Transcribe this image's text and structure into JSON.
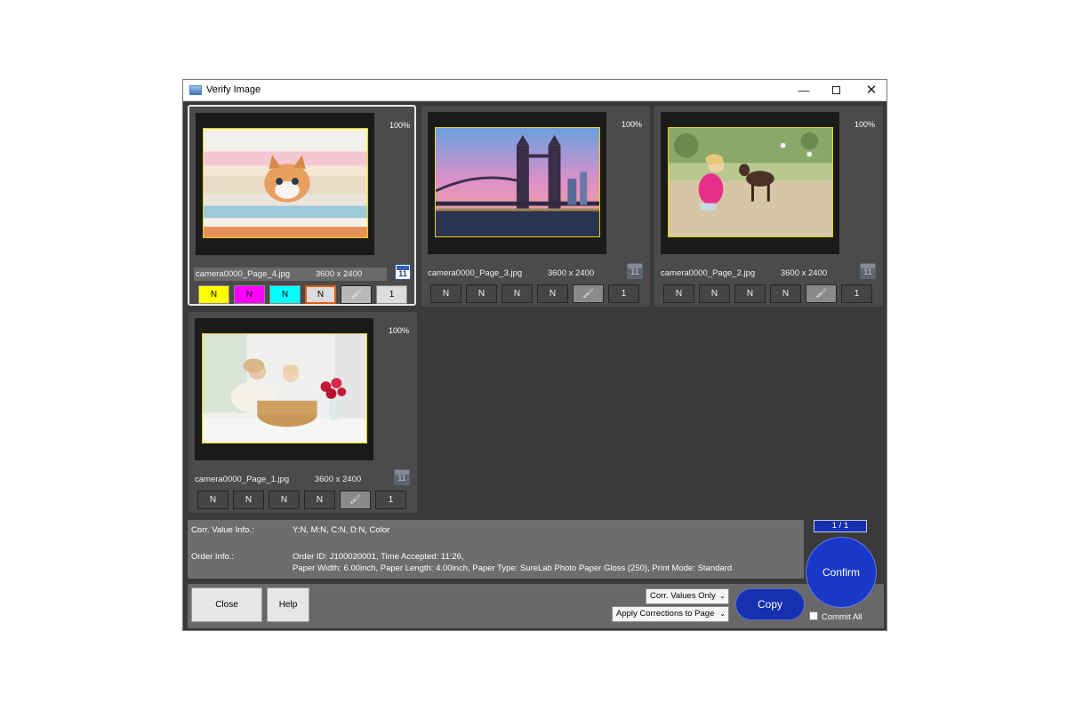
{
  "window": {
    "title": "Verify Image",
    "controls": {
      "minimize": "—",
      "maximize": "",
      "close": "✕"
    }
  },
  "cards": [
    {
      "filename": "camera0000_Page_4.jpg",
      "dimensions": "3600 x 2400",
      "zoom": "100%",
      "calendar_num": "11",
      "selected": true,
      "image_desc": "kitten-on-towels",
      "buttons": {
        "y": "N",
        "m": "N",
        "c": "N",
        "d": "N",
        "count": "1"
      }
    },
    {
      "filename": "camera0000_Page_3.jpg",
      "dimensions": "3600 x 2400",
      "zoom": "100%",
      "calendar_num": "11",
      "selected": false,
      "image_desc": "tower-bridge",
      "buttons": {
        "y": "N",
        "m": "N",
        "c": "N",
        "d": "N",
        "count": "1"
      }
    },
    {
      "filename": "camera0000_Page_2.jpg",
      "dimensions": "3600 x 2400",
      "zoom": "100%",
      "calendar_num": "11",
      "selected": false,
      "image_desc": "girl-with-goat",
      "buttons": {
        "y": "N",
        "m": "N",
        "c": "N",
        "d": "N",
        "count": "1"
      }
    },
    {
      "filename": "camera0000_Page_1.jpg",
      "dimensions": "3600 x 2400",
      "zoom": "100%",
      "calendar_num": "11",
      "selected": false,
      "image_desc": "children-with-basket",
      "buttons": {
        "y": "N",
        "m": "N",
        "c": "N",
        "d": "N",
        "count": "1"
      }
    }
  ],
  "info": {
    "corr_label": "Corr. Value Info.:",
    "corr_value": "Y:N, M:N, C:N, D:N, Color",
    "order_label": "Order Info.:",
    "order_line1": "Order ID: J100020001, Time Accepted:  11:26,",
    "order_line2": "Paper Width: 6.00inch, Paper Length: 4.00inch, Paper Type: SureLab Photo Paper Gloss (250), Print Mode: Standard"
  },
  "bottom": {
    "close_label": "Close",
    "help_label": "Help",
    "corr_values_select": "Corr. Values Only",
    "apply_select": "Apply Corrections to Page",
    "copy_label": "Copy",
    "page_indicator": "1 / 1",
    "confirm_label": "Confirm",
    "commit_all_label": "Commit All"
  },
  "colors": {
    "accent_blue": "#1a38c8",
    "window_bg": "#3a3a3a",
    "card_bg": "#4b4b4b",
    "yellow_btn": "#ffff00",
    "magenta_btn": "#ff00ff",
    "cyan_btn": "#00ffff",
    "selected_outline": "#e25a10"
  }
}
